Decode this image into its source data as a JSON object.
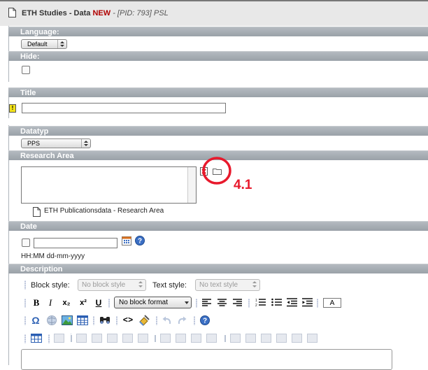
{
  "header": {
    "record_title": "ETH Studies - Data",
    "new_badge": "NEW",
    "pid_text": "- [PID: 793] PSL"
  },
  "language": {
    "label": "Language:",
    "selected": "Default"
  },
  "hide": {
    "label": "Hide:",
    "checked": false
  },
  "title_field": {
    "label": "Title",
    "value": ""
  },
  "datatyp": {
    "label": "Datatyp",
    "selected": "PPS"
  },
  "research_area": {
    "label": "Research Area",
    "link_text": "ETH Publicationsdata - Research Area",
    "annotation": "4.1",
    "annotation_color": "#e8192c"
  },
  "date": {
    "label": "Date",
    "value": "",
    "format_hint": "HH:MM dd-mm-yyyy"
  },
  "description": {
    "label": "Description",
    "block_style_label": "Block style:",
    "block_style_value": "No block style",
    "text_style_label": "Text style:",
    "text_style_value": "No text style",
    "format_value": "No block format",
    "toolbar_glyphs": {
      "bold": "B",
      "italic": "I",
      "subscript": "x₂",
      "superscript": "x²",
      "underline": "U",
      "omega": "Ω",
      "source": "<>",
      "text_color": "A"
    }
  },
  "colors": {
    "section_header": "#a6adb4",
    "accent_blue": "#2b5fb3",
    "warning": "#f2e21a"
  }
}
